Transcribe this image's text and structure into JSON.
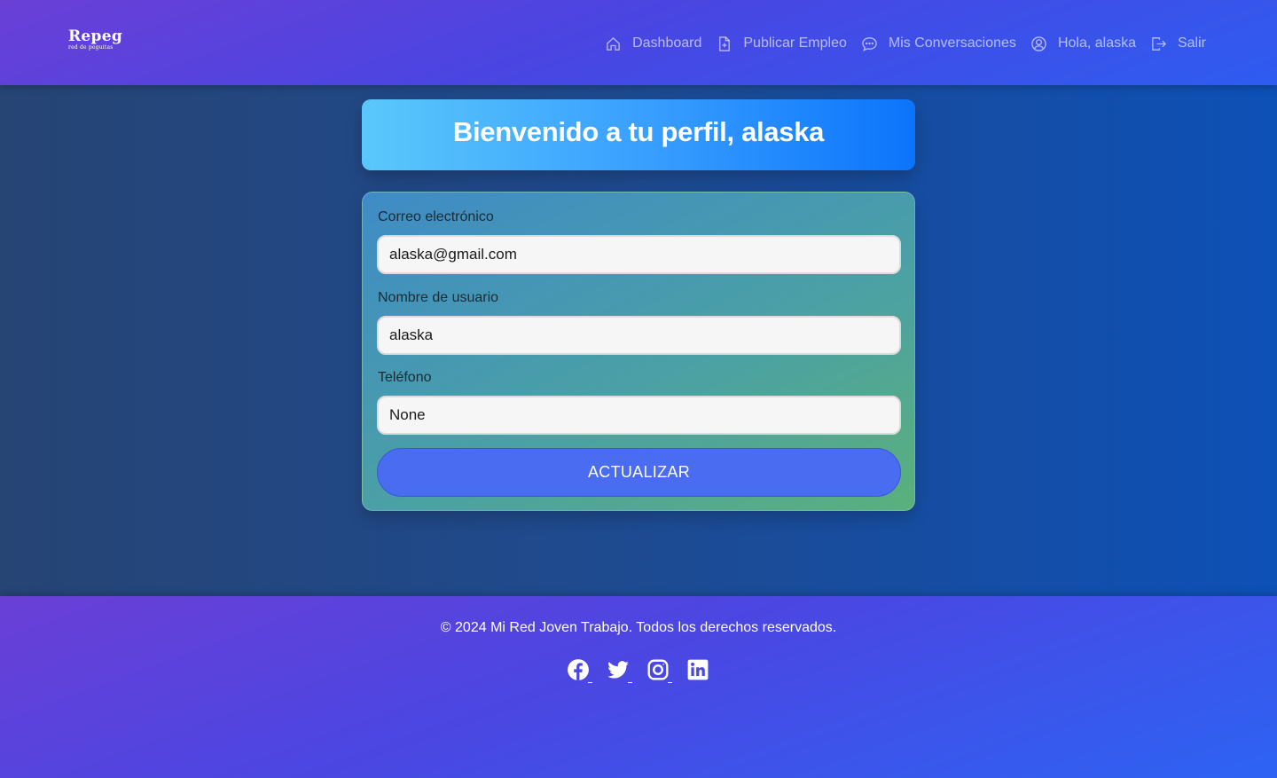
{
  "brand": {
    "name": "Repeg",
    "tagline": "red de peguitas"
  },
  "nav": {
    "dashboard": "Dashboard",
    "post_job": "Publicar Empleo",
    "conversations": "Mis Conversaciones",
    "greeting": "Hola, alaska",
    "logout": "Salir"
  },
  "welcome": {
    "title": "Bienvenido a tu perfil, alaska"
  },
  "form": {
    "email_label": "Correo electrónico",
    "email_value": "alaska@gmail.com",
    "username_label": "Nombre de usuario",
    "username_value": "alaska",
    "phone_label": "Teléfono",
    "phone_value": "None",
    "submit_label": "ACTUALIZAR"
  },
  "footer": {
    "copyright": "© 2024 Mi Red Joven Trabajo. Todos los derechos reservados.",
    "socials": [
      "facebook-icon",
      "twitter-icon",
      "instagram-icon",
      "linkedin-icon"
    ]
  },
  "colors": {
    "header_start": "#6a3fd6",
    "header_end": "#2e5cf0",
    "banner_start": "#5bc8fb",
    "banner_end": "#0b74fb",
    "button": "#4a6cf0"
  }
}
